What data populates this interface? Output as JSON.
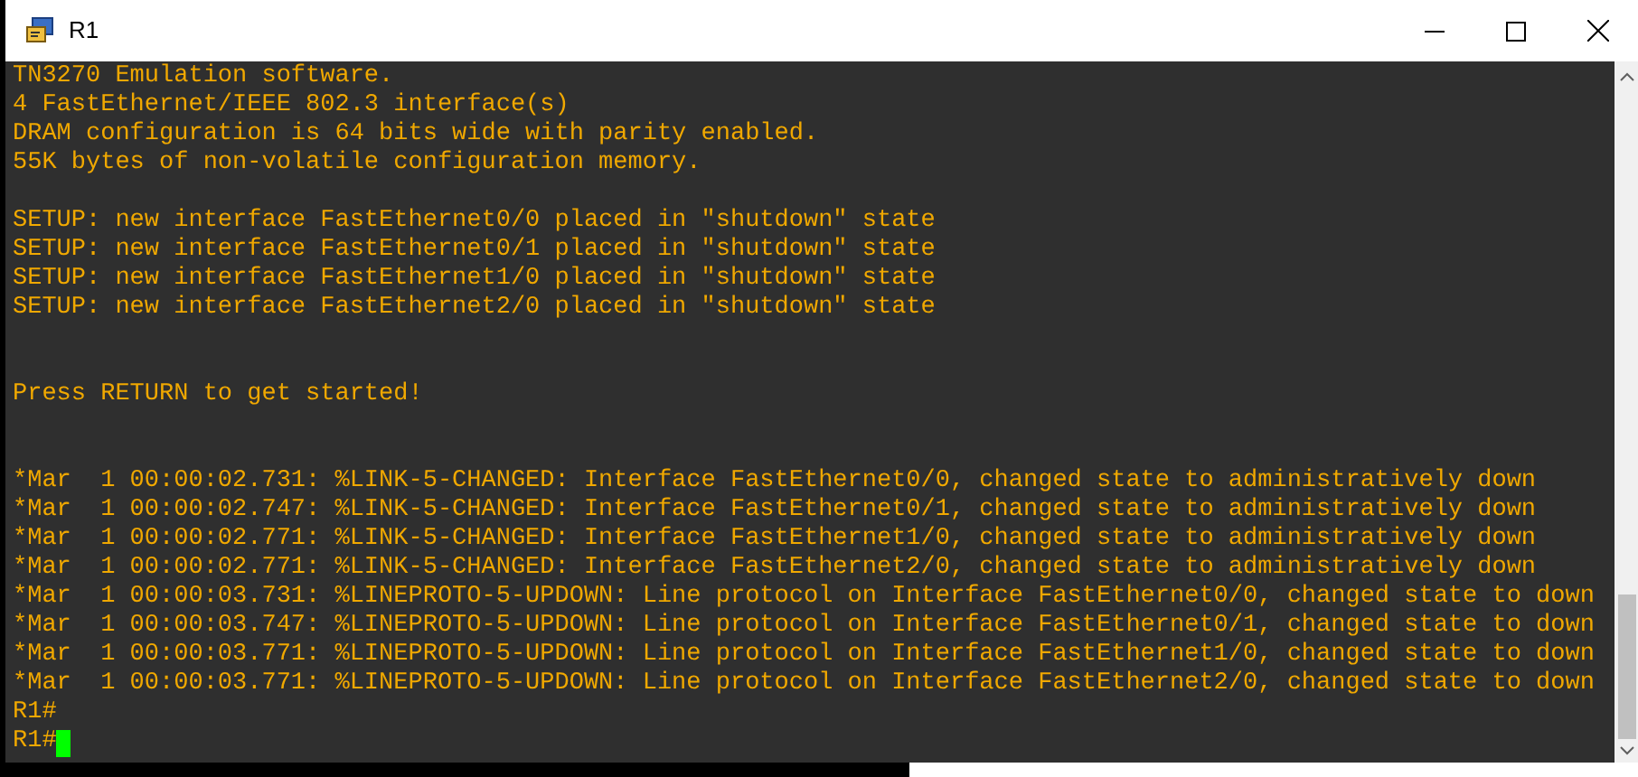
{
  "window": {
    "title": "R1"
  },
  "terminal": {
    "blocks": [
      {
        "lines": [
          "TN3270 Emulation software.",
          "4 FastEthernet/IEEE 802.3 interface(s)",
          "DRAM configuration is 64 bits wide with parity enabled.",
          "55K bytes of non-volatile configuration memory."
        ]
      },
      {
        "lines": [
          "SETUP: new interface FastEthernet0/0 placed in \"shutdown\" state",
          "SETUP: new interface FastEthernet0/1 placed in \"shutdown\" state",
          "SETUP: new interface FastEthernet1/0 placed in \"shutdown\" state",
          "SETUP: new interface FastEthernet2/0 placed in \"shutdown\" state"
        ]
      },
      {
        "lines": [
          "Press RETURN to get started!"
        ]
      },
      {
        "lines": [
          "*Mar  1 00:00:02.731: %LINK-5-CHANGED: Interface FastEthernet0/0, changed state to administratively down",
          "*Mar  1 00:00:02.747: %LINK-5-CHANGED: Interface FastEthernet0/1, changed state to administratively down",
          "*Mar  1 00:00:02.771: %LINK-5-CHANGED: Interface FastEthernet1/0, changed state to administratively down",
          "*Mar  1 00:00:02.771: %LINK-5-CHANGED: Interface FastEthernet2/0, changed state to administratively down",
          "*Mar  1 00:00:03.731: %LINEPROTO-5-UPDOWN: Line protocol on Interface FastEthernet0/0, changed state to down",
          "*Mar  1 00:00:03.747: %LINEPROTO-5-UPDOWN: Line protocol on Interface FastEthernet0/1, changed state to down",
          "*Mar  1 00:00:03.771: %LINEPROTO-5-UPDOWN: Line protocol on Interface FastEthernet1/0, changed state to down",
          "*Mar  1 00:00:03.771: %LINEPROTO-5-UPDOWN: Line protocol on Interface FastEthernet2/0, changed state to down",
          "R1#"
        ]
      }
    ],
    "prompt": "R1#"
  }
}
